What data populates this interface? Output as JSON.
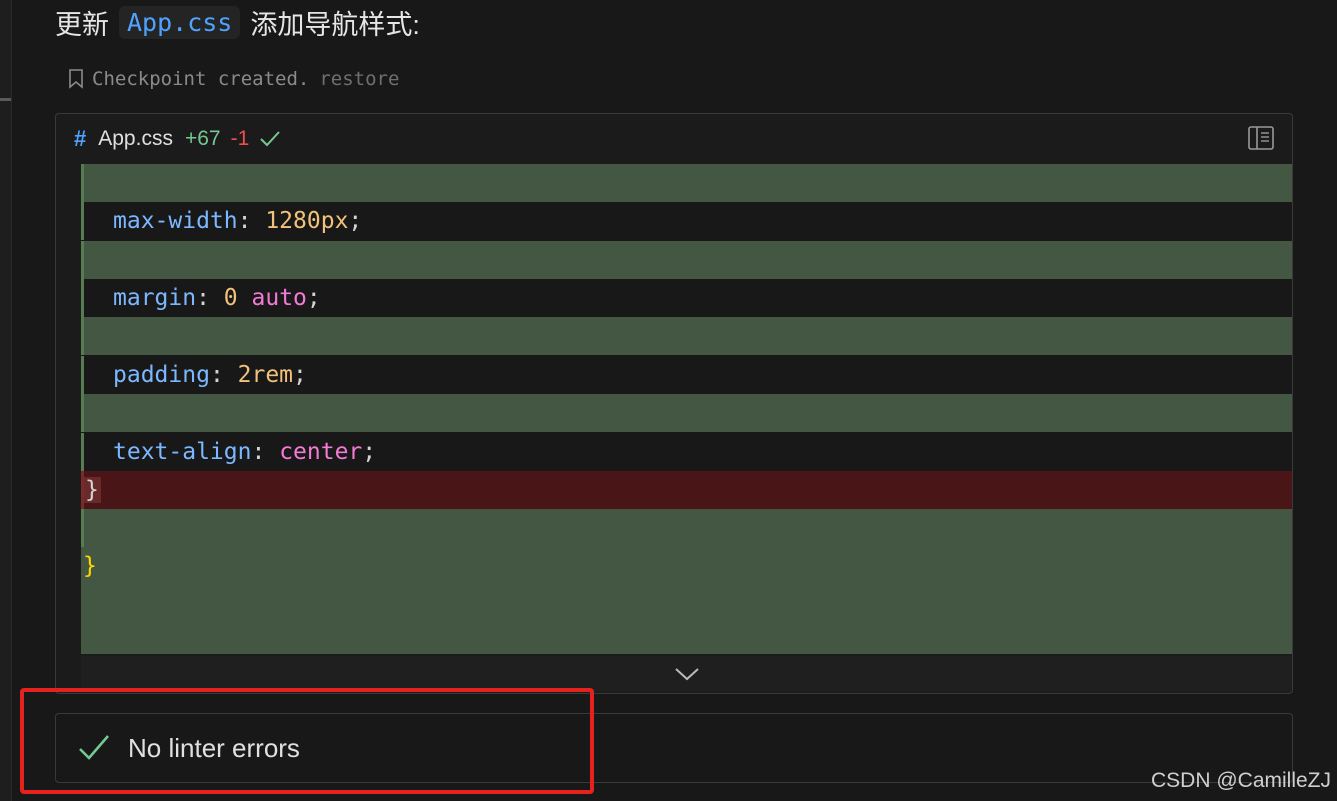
{
  "heading": {
    "prefix": "更新",
    "code": "App.css",
    "suffix": "添加导航样式:"
  },
  "checkpoint": {
    "text": "Checkpoint created.",
    "restore": "restore"
  },
  "diff": {
    "filename": "App.css",
    "hash": "#",
    "added": "+67",
    "removed": "-1",
    "status_icon": "check-icon",
    "lines": {
      "l1": {
        "prop": "max-width",
        "colon": ": ",
        "value": "1280px",
        "end": ";"
      },
      "l2": {
        "prop": "margin",
        "colon": ": ",
        "num": "0",
        "space": " ",
        "kw": "auto",
        "end": ";"
      },
      "l3": {
        "prop": "padding",
        "colon": ": ",
        "value": "2rem",
        "end": ";"
      },
      "l4": {
        "prop": "text-align",
        "colon": ": ",
        "kw": "center",
        "end": ";"
      },
      "del_brace": "}",
      "add_brace": "}"
    }
  },
  "lint": {
    "text": "No linter errors"
  },
  "watermark": "CSDN @CamilleZJ",
  "colors": {
    "added_bg": "#435742",
    "removed_bg": "#4a1516",
    "accent": "#4fa3ff",
    "highlight": "#e5221d"
  }
}
